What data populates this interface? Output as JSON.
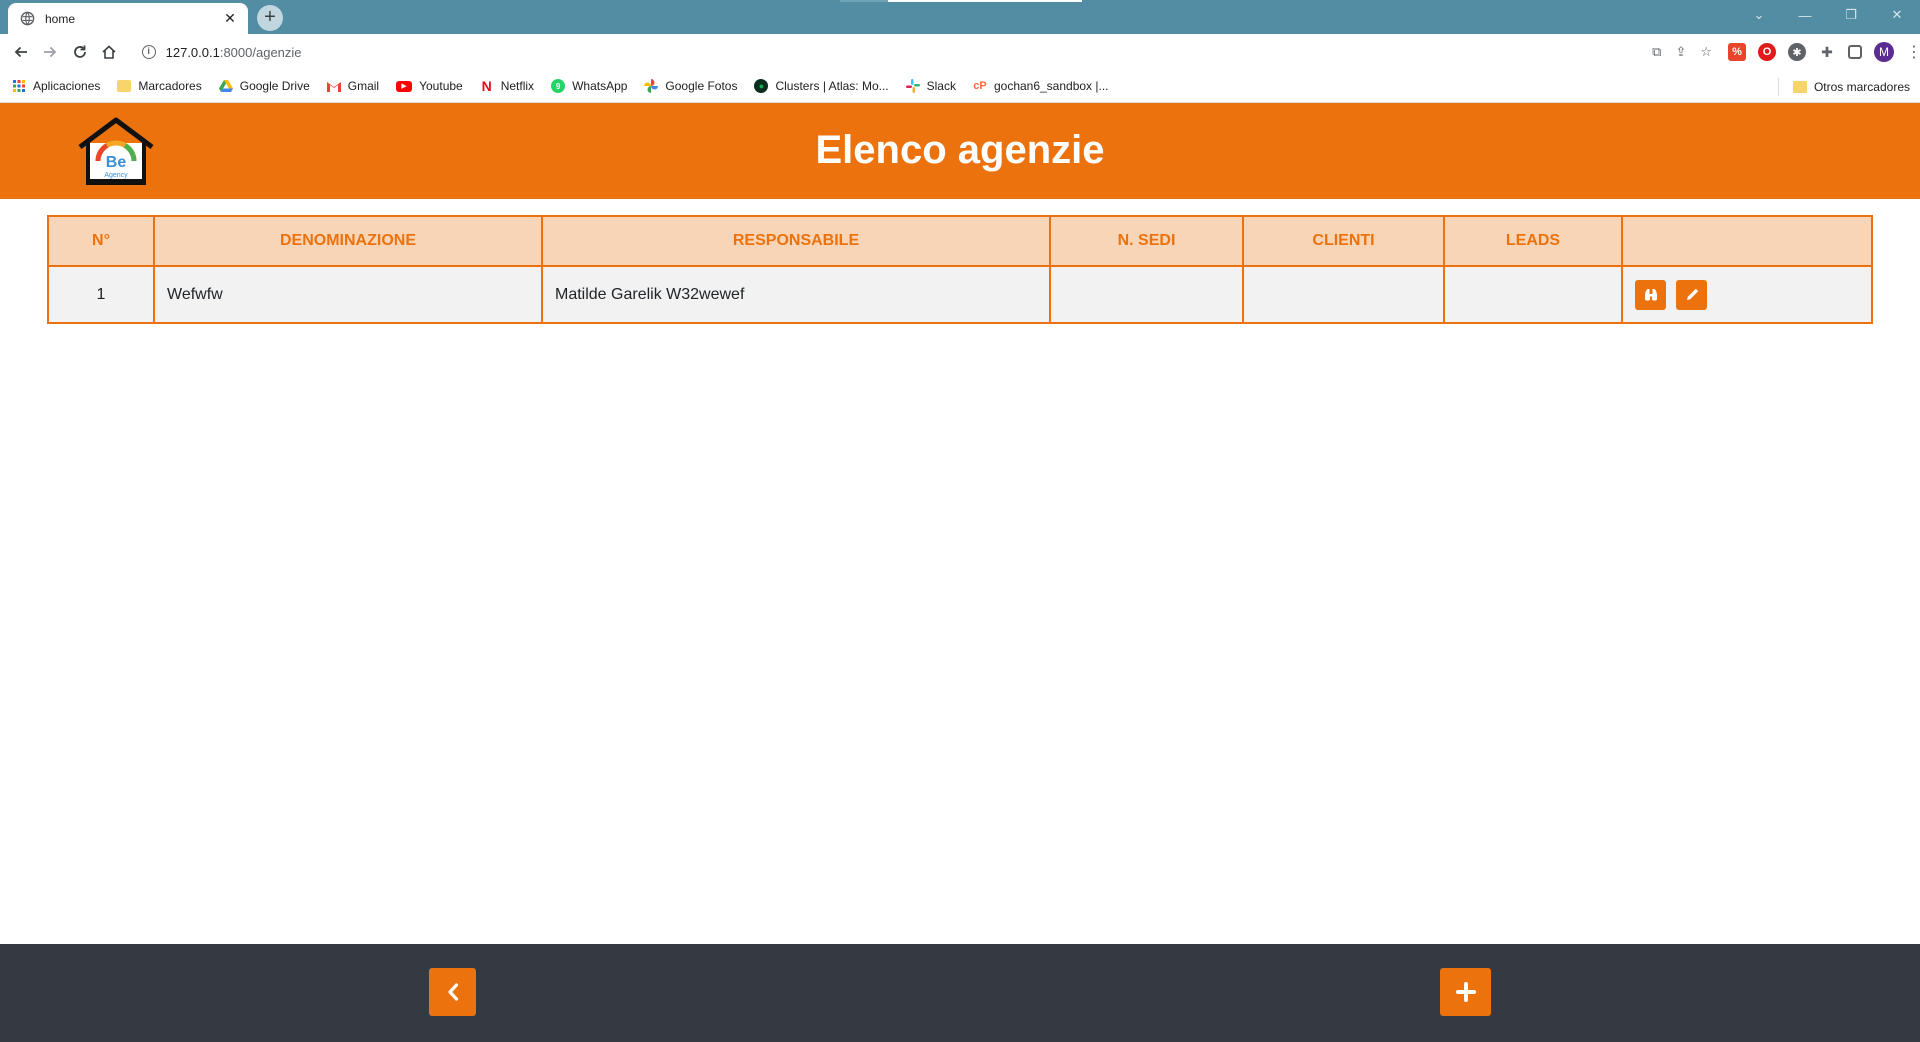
{
  "browser": {
    "tab_title": "home",
    "url_host": "127.0.0.1",
    "url_path": ":8000/agenzie",
    "bookmarks": [
      {
        "label": "Aplicaciones",
        "icon": "apps-grid-icon"
      },
      {
        "label": "Marcadores",
        "icon": "folder-icon"
      },
      {
        "label": "Google Drive",
        "icon": "google-drive-icon"
      },
      {
        "label": "Gmail",
        "icon": "gmail-icon"
      },
      {
        "label": "Youtube",
        "icon": "youtube-icon"
      },
      {
        "label": "Netflix",
        "icon": "netflix-icon"
      },
      {
        "label": "WhatsApp",
        "icon": "whatsapp-icon"
      },
      {
        "label": "Google Fotos",
        "icon": "google-photos-icon"
      },
      {
        "label": "Clusters | Atlas: Mo...",
        "icon": "mongodb-icon"
      },
      {
        "label": "Slack",
        "icon": "slack-icon"
      },
      {
        "label": "gochan6_sandbox |...",
        "icon": "postman-icon"
      }
    ],
    "other_bookmarks": "Otros marcadores",
    "avatar_letter": "M"
  },
  "header": {
    "title": "Elenco agenzie",
    "logo_text": "Be",
    "logo_subtext": "Agency"
  },
  "table": {
    "columns": [
      "N°",
      "DENOMINAZIONE",
      "RESPONSABILE",
      "N. SEDI",
      "CLIENTI",
      "LEADS",
      ""
    ],
    "rows": [
      {
        "n": "1",
        "denominazione": "Wefwfw",
        "responsabile": "Matilde Garelik W32wewef",
        "sedi": "",
        "clienti": "",
        "leads": ""
      }
    ]
  },
  "colors": {
    "accent": "#ec720e",
    "header_row_bg": "#f9d5b8",
    "row_bg": "#f2f2f2",
    "footer_bg": "#343a40",
    "chrome_tabstrip": "#528da3"
  }
}
